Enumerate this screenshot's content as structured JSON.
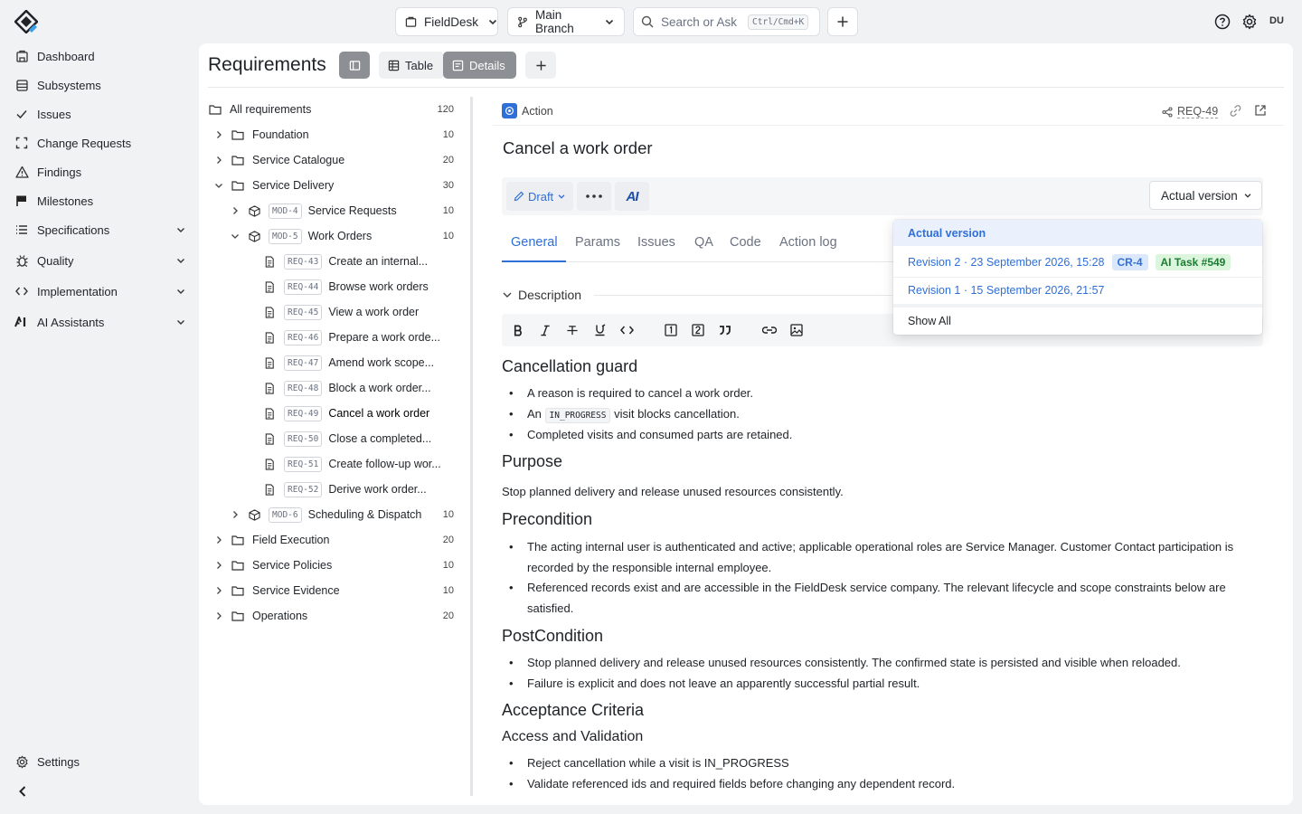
{
  "topbar": {
    "workspace": "FieldDesk",
    "branch": "Main Branch",
    "search_placeholder": "Search or Ask",
    "search_shortcut": "Ctrl/Cmd+K",
    "user_initials": "DU"
  },
  "sidebar": {
    "items": [
      {
        "label": "Dashboard",
        "icon": "building-icon"
      },
      {
        "label": "Subsystems",
        "icon": "database-icon"
      },
      {
        "label": "Issues",
        "icon": "check-icon"
      },
      {
        "label": "Change Requests",
        "icon": "frame-icon"
      },
      {
        "label": "Findings",
        "icon": "warning-icon"
      },
      {
        "label": "Milestones",
        "icon": "flag-icon"
      },
      {
        "label": "Specifications",
        "icon": "list-icon"
      },
      {
        "label": "Quality",
        "icon": "bug-icon"
      },
      {
        "label": "Implementation",
        "icon": "code-icon"
      },
      {
        "label": "AI Assistants",
        "icon": "ai-icon"
      }
    ],
    "settings_label": "Settings"
  },
  "header": {
    "title": "Requirements",
    "view_table": "Table",
    "view_details": "Details"
  },
  "tree": {
    "all_label": "All requirements",
    "all_count": "120",
    "rows": [
      {
        "label": "Foundation",
        "count": "10"
      },
      {
        "label": "Service Catalogue",
        "count": "20"
      },
      {
        "label": "Service Delivery",
        "count": "30"
      },
      {
        "tag": "MOD-4",
        "label": "Service Requests",
        "count": "10"
      },
      {
        "tag": "MOD-5",
        "label": "Work Orders",
        "count": "10"
      },
      {
        "tag": "REQ-43",
        "label": "Create an internal..."
      },
      {
        "tag": "REQ-44",
        "label": "Browse work orders"
      },
      {
        "tag": "REQ-45",
        "label": "View a work order"
      },
      {
        "tag": "REQ-46",
        "label": "Prepare a work orde..."
      },
      {
        "tag": "REQ-47",
        "label": "Amend work scope..."
      },
      {
        "tag": "REQ-48",
        "label": "Block a work order..."
      },
      {
        "tag": "REQ-49",
        "label": "Cancel a work order"
      },
      {
        "tag": "REQ-50",
        "label": "Close a completed..."
      },
      {
        "tag": "REQ-51",
        "label": "Create follow-up wor..."
      },
      {
        "tag": "REQ-52",
        "label": "Derive work order..."
      },
      {
        "tag": "MOD-6",
        "label": "Scheduling & Dispatch",
        "count": "10"
      },
      {
        "label": "Field Execution",
        "count": "20"
      },
      {
        "label": "Service Policies",
        "count": "10"
      },
      {
        "label": "Service Evidence",
        "count": "10"
      },
      {
        "label": "Operations",
        "count": "20"
      }
    ]
  },
  "detail": {
    "type_label": "Action",
    "req_id": "REQ-49",
    "title": "Cancel a work order",
    "status": "Draft",
    "ai_label": "AI",
    "version_select": "Actual version",
    "tabs": [
      "General",
      "Params",
      "Issues",
      "QA",
      "Code",
      "Action log"
    ],
    "section_label": "Description",
    "content": {
      "h_guard": "Cancellation guard",
      "guard_1": "A reason is required to cancel a work order.",
      "guard_2_pre": "An",
      "guard_2_code": "IN_PROGRESS",
      "guard_2_post": "visit blocks cancellation.",
      "guard_3": "Completed visits and consumed parts are retained.",
      "h_purpose": "Purpose",
      "purpose": "Stop planned delivery and release unused resources consistently.",
      "h_pre": "Precondition",
      "pre_1": "The acting internal user is authenticated and active; applicable operational roles are Service Manager. Customer Contact participation is recorded by the responsible internal employee.",
      "pre_2": "Referenced records exist and are accessible in the FieldDesk service company. The relevant lifecycle and scope constraints below are satisfied.",
      "h_post": "PostCondition",
      "post_1": "Stop planned delivery and release unused resources consistently. The confirmed state is persisted and visible when reloaded.",
      "post_2": "Failure is explicit and does not leave an apparently successful partial result.",
      "h_acc": "Acceptance Criteria",
      "h_access": "Access and Validation",
      "acc_1": "Reject cancellation while a visit is IN_PROGRESS",
      "acc_2": "Validate referenced ids and required fields before changing any dependent record."
    }
  },
  "version_dropdown": {
    "actual": "Actual version",
    "rev2": "Revision 2 · 23 September 2026, 15:28",
    "rev2_cr": "CR-4",
    "rev2_ai": "AI Task #549",
    "rev1": "Revision 1 · 15 September 2026, 21:57",
    "show_all": "Show All"
  },
  "colors": {
    "accent": "#2f6fd8",
    "link": "#2f6fd8",
    "green_badge_bg": "#dcf5dd",
    "green_badge_fg": "#1e7b34",
    "blue_badge_bg": "#dbe8fb"
  }
}
